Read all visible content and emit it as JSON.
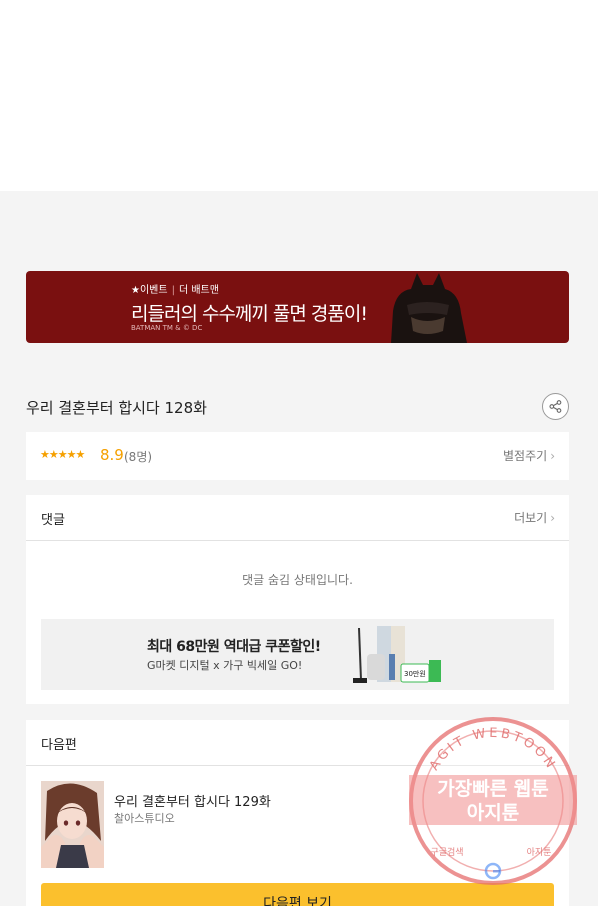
{
  "banner": {
    "tag_event": "★이벤트",
    "tag_title": "더 배트맨",
    "headline": "리들러의 수수께끼 풀면 경품이!",
    "fine_print": "BATMAN TM & © DC"
  },
  "episode": {
    "title": "우리 결혼부터 합시다 128화",
    "share_icon": "share-icon"
  },
  "rating": {
    "stars": "★★★★★",
    "score": "8.9",
    "count": "(8명)",
    "rate_label": "별점주기",
    "chevron": "›"
  },
  "comments": {
    "title": "댓글",
    "more_label": "더보기",
    "chevron": "›",
    "hidden_message": "댓글 숨김 상태입니다.",
    "ad": {
      "title": "최대 68만원 역대급 쿠폰할인!",
      "subtitle": "G마켓 디지털 x 가구 빅세일 GO!",
      "coupon": "30만원"
    }
  },
  "next_episode": {
    "section_title": "다음편",
    "title": "우리 결혼부터 합시다 129화",
    "studio": "찰아스튜디오",
    "button_label": "다음편 보기"
  },
  "watermark": {
    "arc_text": "AGIT WEBTOON",
    "line1": "가장빠른 웹툰",
    "line2": "아지툰",
    "bottom_left": "구글검색",
    "bottom_right": "아지툰"
  },
  "colors": {
    "accent_yellow": "#fbc02d",
    "star_orange": "#f5a000",
    "banner_red": "#7a1010"
  }
}
